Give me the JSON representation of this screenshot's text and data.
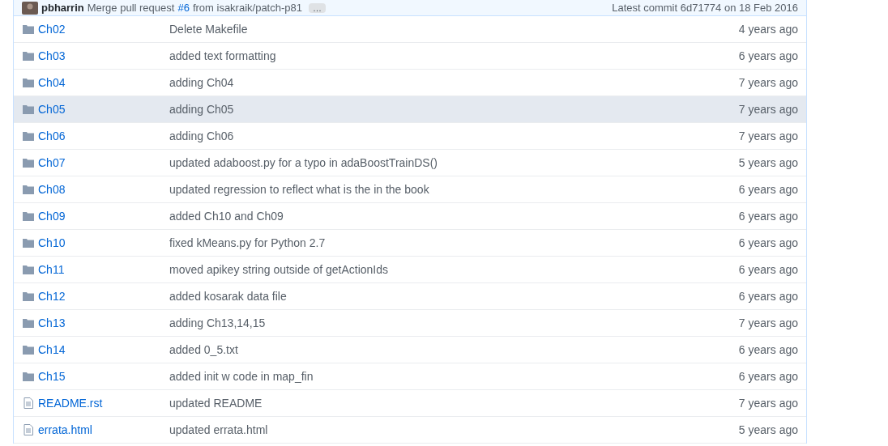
{
  "commit_bar": {
    "author": "pbharrin",
    "message": "Merge pull request",
    "pr_link": "#6",
    "message_rest": "from isakraik/patch-p81",
    "ellipsis": "…",
    "latest": "Latest commit 6d71774 on 18 Feb 2016"
  },
  "files": [
    {
      "kind": "folder",
      "name": "Ch02",
      "message": "Delete Makefile",
      "age": "4 years ago",
      "selected": false
    },
    {
      "kind": "folder",
      "name": "Ch03",
      "message": "added text formatting",
      "age": "6 years ago",
      "selected": false
    },
    {
      "kind": "folder",
      "name": "Ch04",
      "message": "adding Ch04",
      "age": "7 years ago",
      "selected": false
    },
    {
      "kind": "folder",
      "name": "Ch05",
      "message": "adding Ch05",
      "age": "7 years ago",
      "selected": true
    },
    {
      "kind": "folder",
      "name": "Ch06",
      "message": "adding Ch06",
      "age": "7 years ago",
      "selected": false
    },
    {
      "kind": "folder",
      "name": "Ch07",
      "message": "updated adaboost.py for a typo in adaBoostTrainDS()",
      "age": "5 years ago",
      "selected": false
    },
    {
      "kind": "folder",
      "name": "Ch08",
      "message": "updated regression to reflect what is the in the book",
      "age": "6 years ago",
      "selected": false
    },
    {
      "kind": "folder",
      "name": "Ch09",
      "message": "added Ch10 and Ch09",
      "age": "6 years ago",
      "selected": false
    },
    {
      "kind": "folder",
      "name": "Ch10",
      "message": "fixed kMeans.py for Python 2.7",
      "age": "6 years ago",
      "selected": false
    },
    {
      "kind": "folder",
      "name": "Ch11",
      "message": "moved apikey string outside of getActionIds",
      "age": "6 years ago",
      "selected": false
    },
    {
      "kind": "folder",
      "name": "Ch12",
      "message": "added kosarak data file",
      "age": "6 years ago",
      "selected": false
    },
    {
      "kind": "folder",
      "name": "Ch13",
      "message": "adding Ch13,14,15",
      "age": "7 years ago",
      "selected": false
    },
    {
      "kind": "folder",
      "name": "Ch14",
      "message": "added 0_5.txt",
      "age": "6 years ago",
      "selected": false
    },
    {
      "kind": "folder",
      "name": "Ch15",
      "message": "added init w code in map_fin",
      "age": "6 years ago",
      "selected": false
    },
    {
      "kind": "file",
      "name": "README.rst",
      "message": "updated README",
      "age": "7 years ago",
      "selected": false
    },
    {
      "kind": "file",
      "name": "errata.html",
      "message": "updated errata.html",
      "age": "5 years ago",
      "selected": false
    }
  ]
}
